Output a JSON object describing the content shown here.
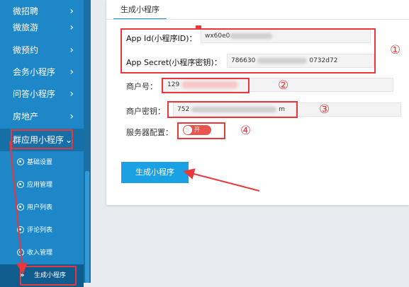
{
  "sidebar": {
    "menu": [
      {
        "label": "微招聘"
      },
      {
        "label": "微旅游"
      },
      {
        "label": "微预约"
      },
      {
        "label": "会务小程序"
      },
      {
        "label": "问答小程序"
      },
      {
        "label": "房地产"
      },
      {
        "label": "群应用小程序"
      }
    ],
    "submenu": [
      {
        "label": "基础设置"
      },
      {
        "label": "应用管理"
      },
      {
        "label": "用户列表"
      },
      {
        "label": "评论列表"
      },
      {
        "label": "收入管理"
      },
      {
        "label": "生成小程序"
      }
    ],
    "chevron": "›",
    "chevron_down": "⌄",
    "double_chevron": "»"
  },
  "main": {
    "tab_label": "生成小程序",
    "fields": {
      "app_id": {
        "label": "App Id(小程序ID)：",
        "value": "wx60e0"
      },
      "app_secret": {
        "label": "App Secret(小程序密钥)：",
        "value_start": "786630",
        "value_end": "0732d72"
      },
      "merchant_no": {
        "label": "商户号：",
        "value": "129"
      },
      "merchant_key": {
        "label": "商户密钥：",
        "value_start": "752",
        "value_end": "m"
      },
      "server_config": {
        "label": "服务器配置：",
        "toggle_text": "开",
        "toggle_on": true
      }
    },
    "generate_button": "生成小程序"
  },
  "annotations": [
    "①",
    "②",
    "③",
    "④"
  ],
  "colors": {
    "sidebar_bg": "#1e87c8",
    "accent": "#1aa0e4",
    "annotation_red": "#e8383b",
    "toggle_on": "#e8554e"
  }
}
